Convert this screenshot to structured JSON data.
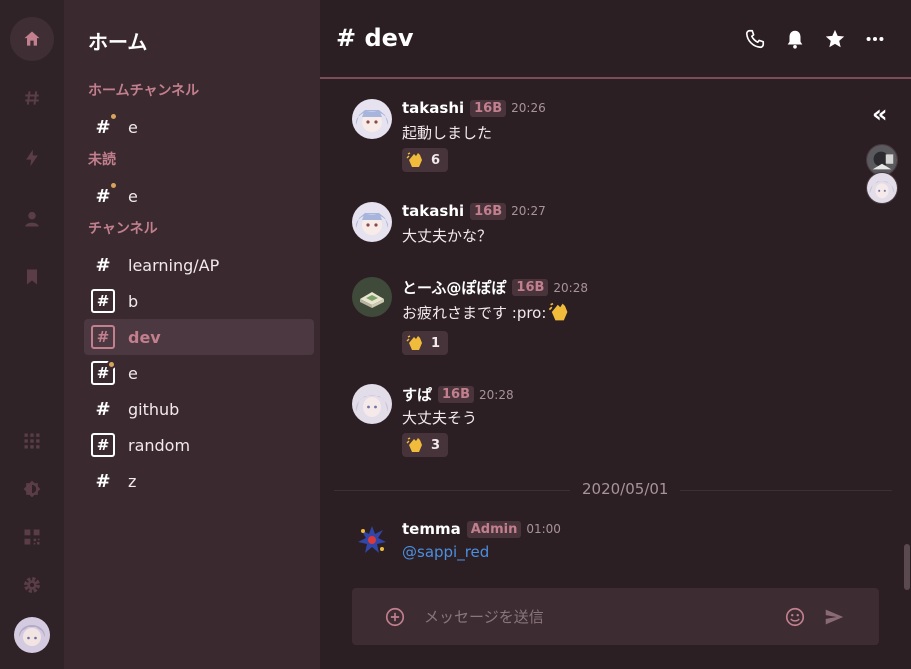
{
  "sidebar": {
    "title": "ホーム",
    "sections": [
      {
        "label": "ホームチャンネル"
      },
      {
        "label": "未読"
      },
      {
        "label": "チャンネル"
      }
    ],
    "home_channels": [
      {
        "name": "e"
      }
    ],
    "unread_channels": [
      {
        "name": "e"
      }
    ],
    "channels": [
      {
        "name": "learning/AP"
      },
      {
        "name": "b"
      },
      {
        "name": "dev"
      },
      {
        "name": "e"
      },
      {
        "name": "github"
      },
      {
        "name": "random"
      },
      {
        "name": "z"
      }
    ],
    "hash": "#"
  },
  "header": {
    "title": "# dev"
  },
  "messages": [
    {
      "user": "takashi",
      "badge": "16B",
      "time": "20:26",
      "text": "起動しました",
      "reaction_count": "6"
    },
    {
      "user": "takashi",
      "badge": "16B",
      "time": "20:27",
      "text": "大丈夫かな？"
    },
    {
      "user": "とーふ@ぽぽぽ",
      "badge": "16B",
      "time": "20:28",
      "text": "お疲れさまです :pro:",
      "reaction_count": "1"
    },
    {
      "user": "すぱ",
      "badge": "16B",
      "time": "20:28",
      "text": "大丈夫そう",
      "reaction_count": "3"
    },
    {
      "user": "temma",
      "badge": "Admin",
      "time": "01:00",
      "text": "@sappi_red"
    }
  ],
  "date_divider": "2020/05/01",
  "side_control": "«",
  "composer": {
    "placeholder": "メッセージを送信"
  },
  "colors": {
    "accent": "#c27f8e",
    "mention": "#4b8fe0",
    "unread_dot": "#d8a45c"
  }
}
